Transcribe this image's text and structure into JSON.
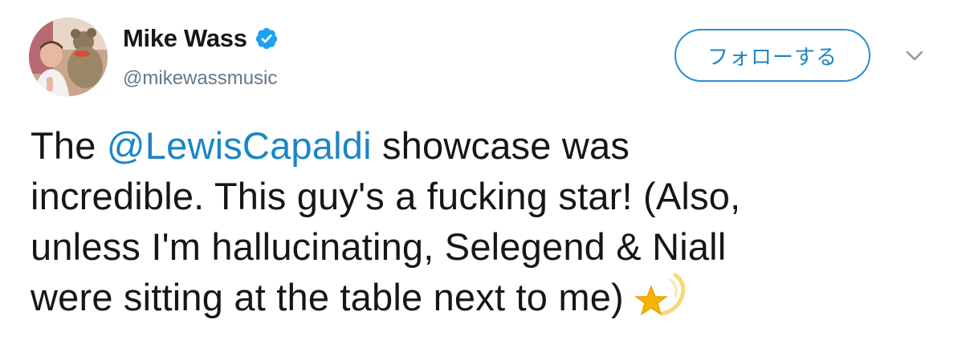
{
  "author": {
    "name": "Mike Wass",
    "handle": "@mikewassmusic",
    "verified": true
  },
  "follow_button": {
    "label": "フォローする"
  },
  "tweet": {
    "line1_pre": "The ",
    "mention": "@LewisCapaldi",
    "line1_post": " showcase was",
    "line2": "incredible. This guy's a fucking star! (Also,",
    "line3": "unless I'm hallucinating, Selegend & Niall",
    "line4": "were sitting at the table next to me)",
    "emoji": "dizzy-star-emoji"
  },
  "colors": {
    "link": "#1b86c6",
    "text": "#14171a",
    "muted": "#657786",
    "verified": "#1da1f2"
  },
  "icons": {
    "verified": "verified-badge-icon",
    "menu": "chevron-down-icon"
  }
}
